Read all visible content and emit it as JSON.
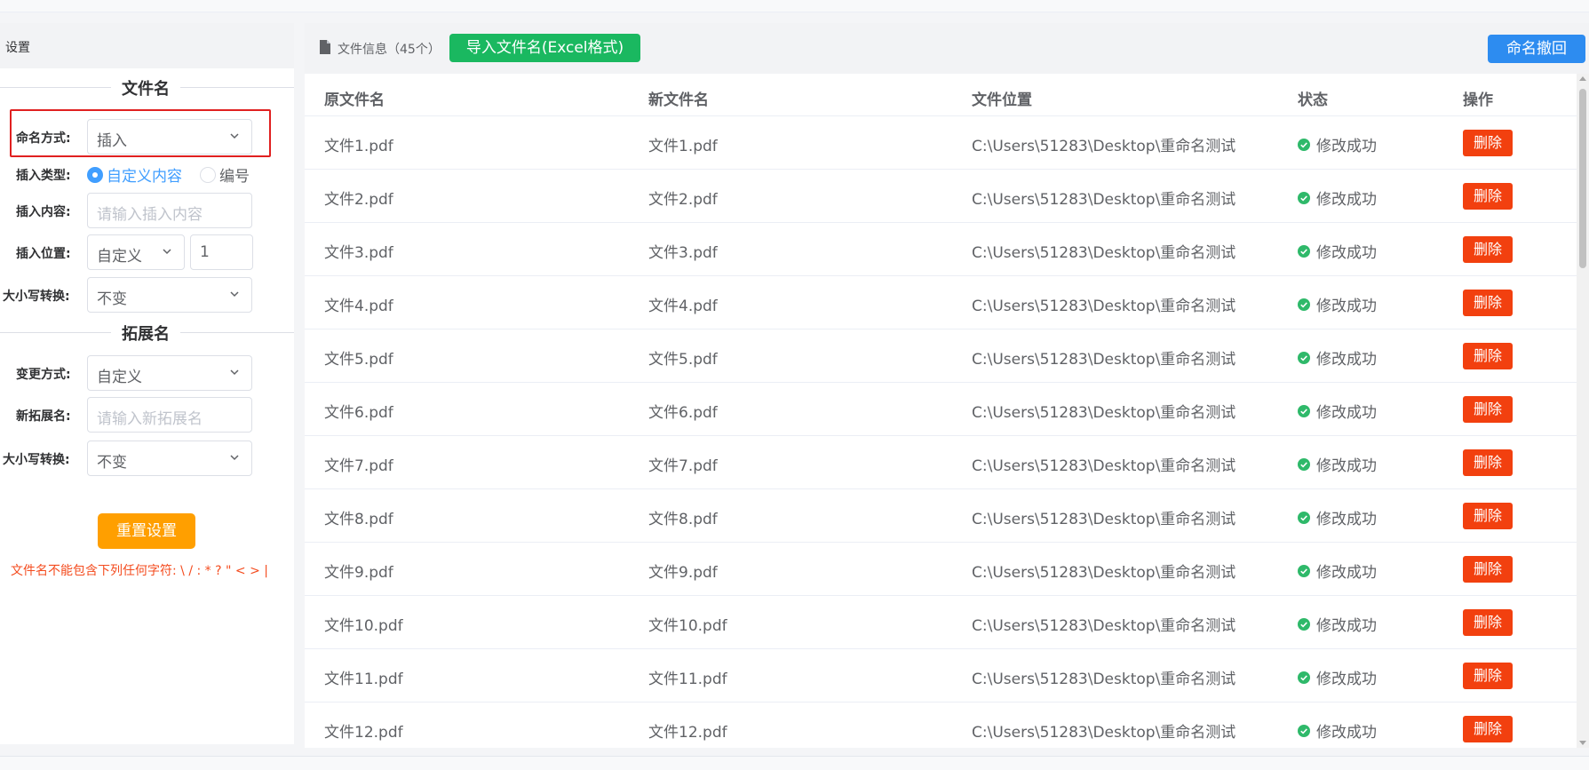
{
  "left_panel": {
    "header": "设置",
    "filename_section": {
      "title": "文件名",
      "naming_mode_label": "命名方式:",
      "naming_mode_value": "插入",
      "insert_type_label": "插入类型:",
      "insert_type_options": [
        "自定义内容",
        "编号"
      ],
      "insert_type_selected": "自定义内容",
      "insert_content_label": "插入内容:",
      "insert_content_placeholder": "请输入插入内容",
      "insert_position_label": "插入位置:",
      "insert_position_value": "自定义",
      "insert_position_number": "1",
      "case_label": "大小写转换:",
      "case_value": "不变"
    },
    "extension_section": {
      "title": "拓展名",
      "change_mode_label": "变更方式:",
      "change_mode_value": "自定义",
      "new_ext_label": "新拓展名:",
      "new_ext_placeholder": "请输入新拓展名",
      "case_label": "大小写转换:",
      "case_value": "不变"
    },
    "reset_button": "重置设置",
    "warning": "文件名不能包含下列任何字符: \\ / : * ? \" < > |"
  },
  "right_panel": {
    "file_info_label": "文件信息（45个）",
    "import_button": "导入文件名(Excel格式)",
    "undo_button": "命名撤回",
    "columns": [
      "原文件名",
      "新文件名",
      "文件位置",
      "状态",
      "操作"
    ],
    "rows": [
      {
        "original": "文件1.pdf",
        "new": "文件1.pdf",
        "location": "C:\\Users\\51283\\Desktop\\重命名测试",
        "status": "修改成功",
        "action": "删除"
      },
      {
        "original": "文件2.pdf",
        "new": "文件2.pdf",
        "location": "C:\\Users\\51283\\Desktop\\重命名测试",
        "status": "修改成功",
        "action": "删除"
      },
      {
        "original": "文件3.pdf",
        "new": "文件3.pdf",
        "location": "C:\\Users\\51283\\Desktop\\重命名测试",
        "status": "修改成功",
        "action": "删除"
      },
      {
        "original": "文件4.pdf",
        "new": "文件4.pdf",
        "location": "C:\\Users\\51283\\Desktop\\重命名测试",
        "status": "修改成功",
        "action": "删除"
      },
      {
        "original": "文件5.pdf",
        "new": "文件5.pdf",
        "location": "C:\\Users\\51283\\Desktop\\重命名测试",
        "status": "修改成功",
        "action": "删除"
      },
      {
        "original": "文件6.pdf",
        "new": "文件6.pdf",
        "location": "C:\\Users\\51283\\Desktop\\重命名测试",
        "status": "修改成功",
        "action": "删除"
      },
      {
        "original": "文件7.pdf",
        "new": "文件7.pdf",
        "location": "C:\\Users\\51283\\Desktop\\重命名测试",
        "status": "修改成功",
        "action": "删除"
      },
      {
        "original": "文件8.pdf",
        "new": "文件8.pdf",
        "location": "C:\\Users\\51283\\Desktop\\重命名测试",
        "status": "修改成功",
        "action": "删除"
      },
      {
        "original": "文件9.pdf",
        "new": "文件9.pdf",
        "location": "C:\\Users\\51283\\Desktop\\重命名测试",
        "status": "修改成功",
        "action": "删除"
      },
      {
        "original": "文件10.pdf",
        "new": "文件10.pdf",
        "location": "C:\\Users\\51283\\Desktop\\重命名测试",
        "status": "修改成功",
        "action": "删除"
      },
      {
        "original": "文件11.pdf",
        "new": "文件11.pdf",
        "location": "C:\\Users\\51283\\Desktop\\重命名测试",
        "status": "修改成功",
        "action": "删除"
      },
      {
        "original": "文件12.pdf",
        "new": "文件12.pdf",
        "location": "C:\\Users\\51283\\Desktop\\重命名测试",
        "status": "修改成功",
        "action": "删除"
      }
    ]
  },
  "colors": {
    "import_green": "#1ab860",
    "undo_blue": "#2d8cf0",
    "reset_orange": "#ff9f00",
    "delete_red": "#f2400f",
    "success_green": "#2fb96a",
    "highlight_red": "#e02020",
    "radio_blue": "#409eff"
  },
  "icons": {
    "file_info": "file-icon",
    "status": "check-circle-icon",
    "select": "chevron-down-icon"
  }
}
